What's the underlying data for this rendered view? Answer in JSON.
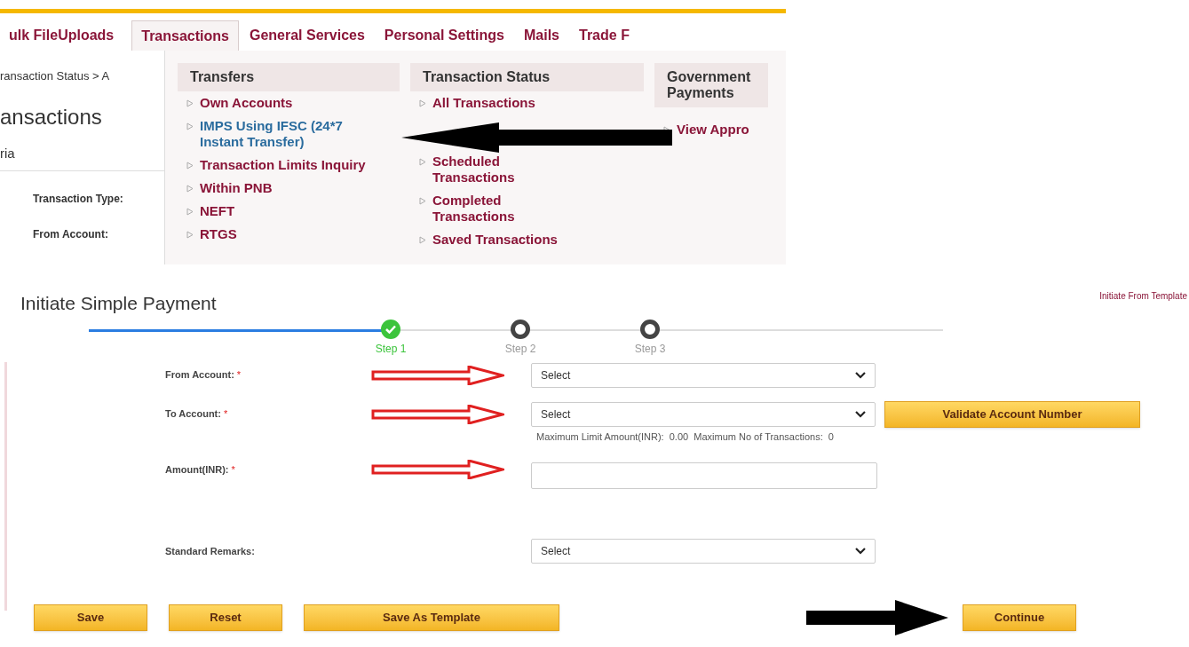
{
  "nav_tabs": [
    {
      "label": "ulk FileUploads",
      "selected": false
    },
    {
      "label": "Transactions",
      "selected": true
    },
    {
      "label": "General Services",
      "selected": false
    },
    {
      "label": "Personal Settings",
      "selected": false
    },
    {
      "label": "Mails",
      "selected": false
    },
    {
      "label": "Trade F",
      "selected": false
    }
  ],
  "background_page": {
    "breadcrumb": "ransaction Status > A",
    "heading": "ansactions",
    "section": "ria",
    "labels": [
      "Transaction Type:",
      "From Account:"
    ]
  },
  "menu_columns": [
    {
      "title": "Transfers",
      "items": [
        {
          "label": "Own Accounts",
          "selected": false
        },
        {
          "label": "IMPS Using IFSC (24*7 Instant Transfer)",
          "selected": true
        },
        {
          "label": "Transaction Limits Inquiry",
          "selected": false
        },
        {
          "label": "Within PNB",
          "selected": false
        },
        {
          "label": "NEFT",
          "selected": false
        },
        {
          "label": "RTGS",
          "selected": false
        }
      ]
    },
    {
      "title": "Transaction Status",
      "items": [
        {
          "label": "All Transactions",
          "selected": false
        },
        {
          "label": "Scheduled Transactions",
          "selected": false
        },
        {
          "label": "Completed Transactions",
          "selected": false
        },
        {
          "label": "Saved Transactions",
          "selected": false
        }
      ]
    },
    {
      "title": "Government Payments",
      "items": [
        {
          "label": "View Appro",
          "selected": false
        }
      ]
    }
  ],
  "payment": {
    "title": "Initiate Simple Payment",
    "template_link": "Initiate From Template",
    "steps": [
      {
        "label": "Step 1",
        "done": true
      },
      {
        "label": "Step 2",
        "done": false
      },
      {
        "label": "Step 3",
        "done": false
      }
    ],
    "fields": [
      {
        "kind": "select",
        "label": "From Account:",
        "required_mark": "*",
        "value": "Select",
        "annotated": true
      },
      {
        "kind": "select",
        "label": "To Account:",
        "required_mark": "*",
        "value": "Select",
        "annotated": true,
        "button": "Validate Account Number",
        "note": "Maximum Limit Amount(INR):  0.00  Maximum No of Transactions:  0"
      },
      {
        "kind": "input",
        "label": "Amount(INR):",
        "required_mark": "*",
        "annotated": true
      },
      {
        "kind": "select",
        "label": "Standard Remarks:",
        "value": "Select",
        "annotated": false
      }
    ],
    "buttons": [
      "Save",
      "Reset",
      "Save As Template"
    ],
    "primary_button": "Continue"
  }
}
